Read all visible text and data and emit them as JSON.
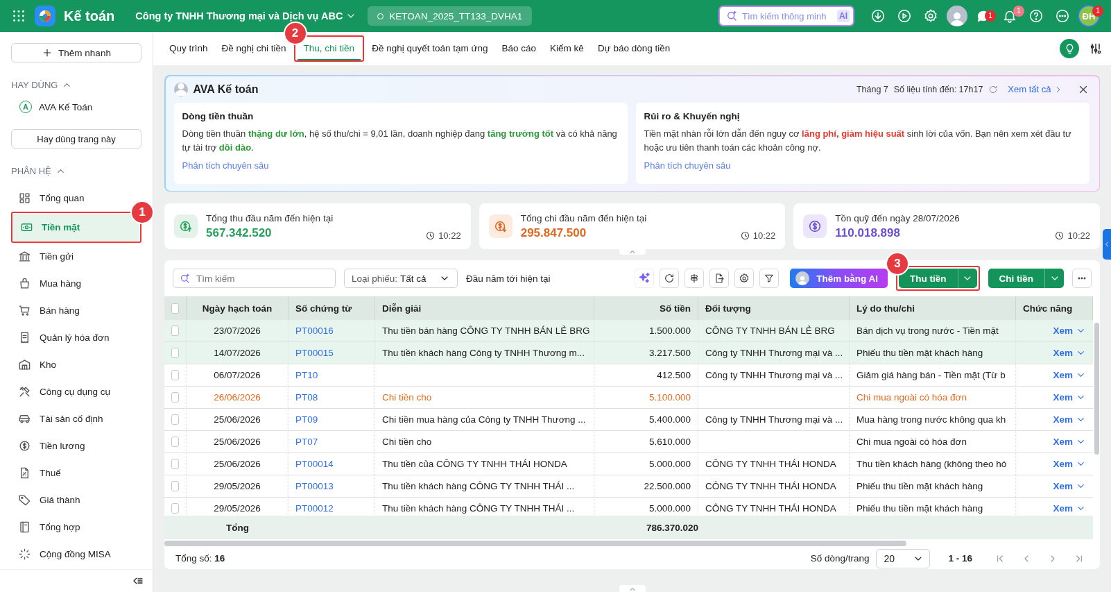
{
  "top_bar": {
    "app_name": "Kế toán",
    "company": "Công ty TNHH Thương mại và Dịch vụ ABC",
    "database": "KETOAN_2025_TT133_DVHA1",
    "search": {
      "placeholder": "Tìm kiếm thông minh",
      "badge": "AI"
    },
    "chat_count": "1",
    "notification_count": "1",
    "user": {
      "initials": "ĐH",
      "badge": "1"
    }
  },
  "sidebar": {
    "quick_add": "Thêm nhanh",
    "favorites": {
      "title": "HAY DÙNG",
      "expanded": true,
      "items": [
        {
          "label": "AVA Kế Toán",
          "icon_letter": "A"
        }
      ],
      "pin_button": "Hay dùng trang này"
    },
    "modules": {
      "title": "PHÂN HỆ",
      "expanded": true,
      "items": [
        {
          "label": "Tổng quan",
          "selected": false
        },
        {
          "label": "Tiền mặt",
          "selected": true,
          "callout": "1"
        },
        {
          "label": "Tiền gửi",
          "selected": false
        },
        {
          "label": "Mua hàng",
          "selected": false
        },
        {
          "label": "Bán hàng",
          "selected": false
        },
        {
          "label": "Quản lý hóa đơn",
          "selected": false
        },
        {
          "label": "Kho",
          "selected": false
        },
        {
          "label": "Công cụ dụng cụ",
          "selected": false
        },
        {
          "label": "Tài sản cố định",
          "selected": false
        },
        {
          "label": "Tiền lương",
          "selected": false
        },
        {
          "label": "Thuế",
          "selected": false
        },
        {
          "label": "Giá thành",
          "selected": false
        },
        {
          "label": "Tổng hợp",
          "selected": false
        },
        {
          "label": "Cộng đồng MISA",
          "selected": false
        }
      ]
    }
  },
  "tabs": [
    {
      "label": "Quy trình",
      "selected": false
    },
    {
      "label": "Đề nghị chi tiền",
      "selected": false
    },
    {
      "label": "Thu, chi tiền",
      "selected": true,
      "callout": "2"
    },
    {
      "label": "Đề nghị quyết toán tạm ứng",
      "selected": false
    },
    {
      "label": "Báo cáo",
      "selected": false
    },
    {
      "label": "Kiểm kê",
      "selected": false
    },
    {
      "label": "Dự báo dòng tiền",
      "selected": false
    }
  ],
  "ava_panel": {
    "title": "AVA Kế toán",
    "month": "Tháng 7",
    "updated": "Số liệu tính đến: 17h17",
    "view_all": "Xem tất cả",
    "cards": [
      {
        "title": "Dòng tiền thuần",
        "segments": [
          {
            "text": "Dòng tiền thuần ",
            "kind": "plain"
          },
          {
            "text": "thặng dư lớn",
            "kind": "positive"
          },
          {
            "text": ", hệ số thu/chi = 9,01 lần, doanh nghiệp đang ",
            "kind": "plain"
          },
          {
            "text": "tăng trưởng tốt",
            "kind": "positive"
          },
          {
            "text": " và có khả năng tự tài trợ ",
            "kind": "plain"
          },
          {
            "text": "dồi dào",
            "kind": "positive"
          },
          {
            "text": ".",
            "kind": "plain"
          }
        ],
        "link": "Phân tích chuyên sâu"
      },
      {
        "title": "Rủi ro & Khuyến nghị",
        "segments": [
          {
            "text": "Tiền mặt nhàn rỗi lớn dẫn đến nguy cơ ",
            "kind": "plain"
          },
          {
            "text": "lãng phí, giảm hiệu suất",
            "kind": "negative"
          },
          {
            "text": " sinh lời của vốn. Bạn nên xem xét đầu tư hoặc ưu tiên thanh toán các khoản công nợ.",
            "kind": "plain"
          }
        ],
        "link": "Phân tích chuyên sâu"
      }
    ]
  },
  "stats": [
    {
      "kind": "income",
      "label": "Tổng thu đầu năm đến hiện tại",
      "value": "567.342.520",
      "color": "#27a05a",
      "time": "10:22"
    },
    {
      "kind": "expense",
      "label": "Tổng chi đầu năm đến hiện tại",
      "value": "295.847.500",
      "color": "#e0691f",
      "time": "10:22"
    },
    {
      "kind": "balance",
      "label": "Tồn quỹ đến ngày 28/07/2026",
      "value": "110.018.898",
      "color": "#6a4fd0",
      "time": "10:22"
    }
  ],
  "toolbar": {
    "search_placeholder": "Tìm kiếm",
    "type_filter": {
      "label": "Loại phiếu:",
      "value": "Tất cả"
    },
    "period": "Đầu năm tới hiện tại",
    "ai_button": "Thêm bằng AI",
    "receive_button": {
      "label": "Thu tiền",
      "callout": "3"
    },
    "pay_button": {
      "label": "Chi tiền"
    }
  },
  "table": {
    "all_checked": false,
    "columns": [
      "Ngày hạch toán",
      "Số chứng từ",
      "Diễn giải",
      "Số tiền",
      "Đối tượng",
      "Lý do thu/chi",
      "Chức năng"
    ],
    "rows": [
      {
        "date": "23/07/2026",
        "voucher": "PT00016",
        "description": "Thu tiền bán hàng CÔNG TY TNHH BÁN LẺ BRG",
        "amount": "1.500.000",
        "party": "CÔNG TY TNHH BÁN LẺ BRG",
        "reason": "Bán dịch vụ trong nước - Tiền mặt",
        "action": "Xem",
        "checked": false,
        "selected": true,
        "kind": "normal"
      },
      {
        "date": "14/07/2026",
        "voucher": "PT00015",
        "description": "Thu tiền khách hàng Công ty TNHH Thương m...",
        "amount": "3.217.500",
        "party": "Công ty TNHH Thương mại và ...",
        "reason": "Phiếu thu tiền mặt khách hàng",
        "action": "Xem",
        "checked": false,
        "selected": true,
        "kind": "normal"
      },
      {
        "date": "06/07/2026",
        "voucher": "PT10",
        "amount": "412.500",
        "party": "Công ty TNHH Thương mại và ...",
        "reason": "Giảm giá hàng bán - Tiền mặt (Từ b",
        "action": "Xem",
        "checked": false,
        "selected": false,
        "kind": "normal"
      },
      {
        "date": "26/06/2026",
        "voucher": "PT08",
        "description": "Chi tiền cho",
        "amount": "5.100.000",
        "reason": "Chi mua ngoài có hóa đơn",
        "action": "Xem",
        "checked": false,
        "selected": false,
        "kind": "warning"
      },
      {
        "date": "25/06/2026",
        "voucher": "PT09",
        "description": "Chi tiền mua hàng của Công ty TNHH Thương ...",
        "amount": "5.400.000",
        "party": "Công ty TNHH Thương mại và ...",
        "reason": "Mua hàng trong nước không qua kh",
        "action": "Xem",
        "checked": false,
        "selected": false,
        "kind": "normal"
      },
      {
        "date": "25/06/2026",
        "voucher": "PT07",
        "description": "Chi tiền cho",
        "amount": "5.610.000",
        "reason": "Chi mua ngoài có hóa đơn",
        "action": "Xem",
        "checked": false,
        "selected": false,
        "kind": "normal"
      },
      {
        "date": "25/06/2026",
        "voucher": "PT00014",
        "description": "Thu tiền của CÔNG TY TNHH THÁI HONDA",
        "amount": "5.000.000",
        "party": "CÔNG TY TNHH THÁI HONDA",
        "reason": "Thu tiền khách hàng (không theo hó",
        "action": "Xem",
        "checked": false,
        "selected": false,
        "kind": "normal"
      },
      {
        "date": "29/05/2026",
        "voucher": "PT00013",
        "description": "Thu tiền khách hàng CÔNG TY TNHH THÁI ...",
        "amount": "22.500.000",
        "party": "CÔNG TY TNHH THÁI HONDA",
        "reason": "Phiếu thu tiền mặt khách hàng",
        "action": "Xem",
        "checked": false,
        "selected": false,
        "kind": "normal"
      },
      {
        "date": "29/05/2026",
        "voucher": "PT00012",
        "description": "Thu tiền khách hàng CÔNG TY TNHH THÁI ...",
        "amount": "5.000.000",
        "party": "CÔNG TY TNHH THÁI HONDA",
        "reason": "Phiếu thu tiền mặt khách hàng",
        "action": "Xem",
        "checked": false,
        "selected": false,
        "kind": "normal"
      }
    ],
    "total": {
      "label": "Tổng",
      "amount": "786.370.020"
    }
  },
  "footer": {
    "total_label": "Tổng số:",
    "total_count": "16",
    "page_size_label": "Số dòng/trang",
    "page_size": "20",
    "range": "1 - 16"
  }
}
